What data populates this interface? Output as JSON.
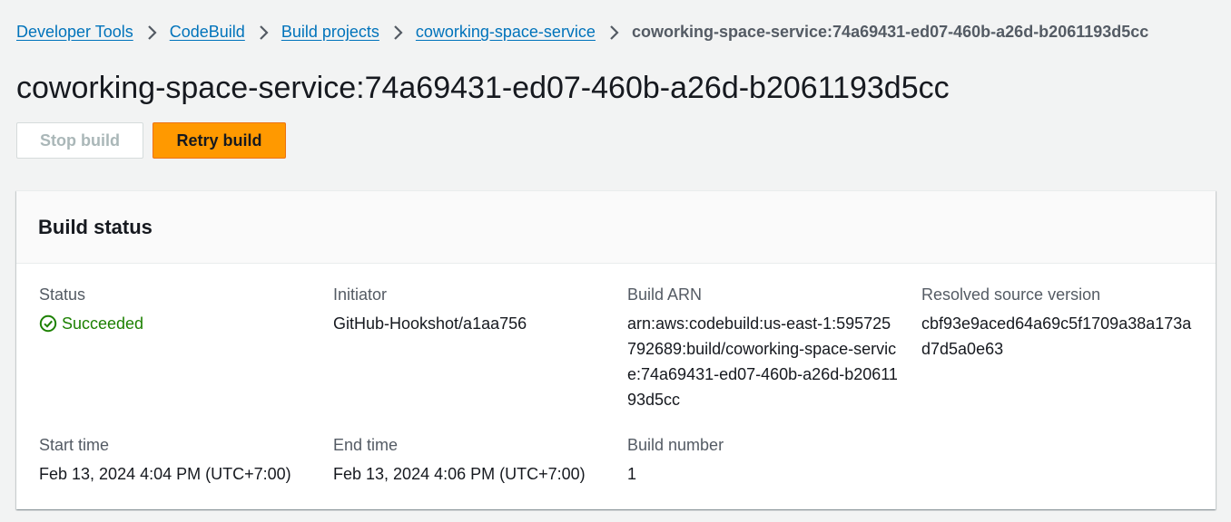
{
  "breadcrumb": {
    "items": [
      {
        "label": "Developer Tools"
      },
      {
        "label": "CodeBuild"
      },
      {
        "label": "Build projects"
      },
      {
        "label": "coworking-space-service"
      }
    ],
    "current": "coworking-space-service:74a69431-ed07-460b-a26d-b2061193d5cc"
  },
  "page": {
    "title": "coworking-space-service:74a69431-ed07-460b-a26d-b2061193d5cc"
  },
  "actions": {
    "stop_label": "Stop build",
    "retry_label": "Retry build"
  },
  "build_status": {
    "title": "Build status",
    "status": {
      "label": "Status",
      "value": "Succeeded"
    },
    "initiator": {
      "label": "Initiator",
      "value": "GitHub-Hookshot/a1aa756"
    },
    "arn": {
      "label": "Build ARN",
      "value": "arn:aws:codebuild:us-east-1:595725792689:build/coworking-space-service:74a69431-ed07-460b-a26d-b2061193d5cc"
    },
    "source_version": {
      "label": "Resolved source version",
      "value": "cbf93e9aced64a69c5f1709a38a173ad7d5a0e63"
    },
    "start_time": {
      "label": "Start time",
      "value": "Feb 13, 2024 4:04 PM (UTC+7:00)"
    },
    "end_time": {
      "label": "End time",
      "value": "Feb 13, 2024 4:06 PM (UTC+7:00)"
    },
    "build_number": {
      "label": "Build number",
      "value": "1"
    }
  },
  "colors": {
    "link": "#0073bb",
    "primary": "#ff9900",
    "success": "#1d8102"
  }
}
